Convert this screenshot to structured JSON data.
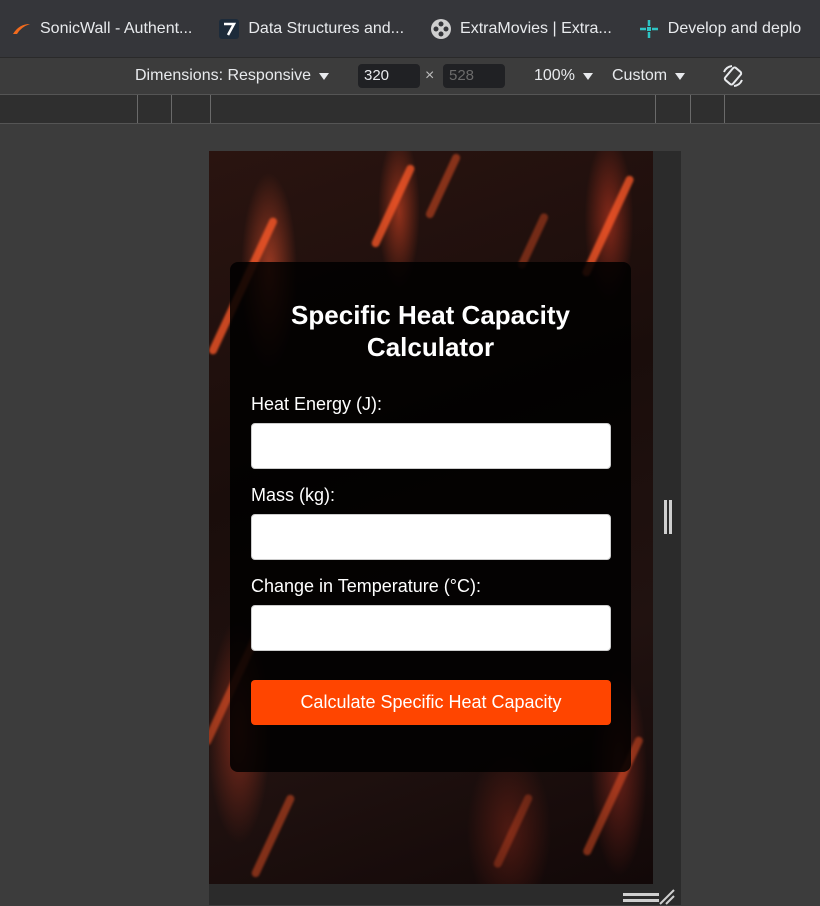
{
  "bookmarks": [
    {
      "label": "SonicWall - Authent...",
      "icon": "sonicwall-icon"
    },
    {
      "label": "Data Structures and...",
      "icon": "data-structures-icon"
    },
    {
      "label": "ExtraMovies | Extra...",
      "icon": "film-reel-icon"
    },
    {
      "label": "Develop and deplo",
      "icon": "deploy-icon"
    }
  ],
  "device_toolbar": {
    "dimensions_label": "Dimensions: Responsive",
    "width": "320",
    "height": "528",
    "zoom": "100%",
    "throttle": "Custom"
  },
  "calculator": {
    "title_line1": "Specific Heat Capacity",
    "title_line2": "Calculator",
    "heat_label": "Heat Energy (J):",
    "mass_label": "Mass (kg):",
    "temp_label": "Change in Temperature (°C):",
    "heat_value": "",
    "mass_value": "",
    "temp_value": "",
    "button_label": "Calculate Specific Heat Capacity"
  },
  "colors": {
    "accent": "#ff4500",
    "card_bg": "#000000"
  }
}
